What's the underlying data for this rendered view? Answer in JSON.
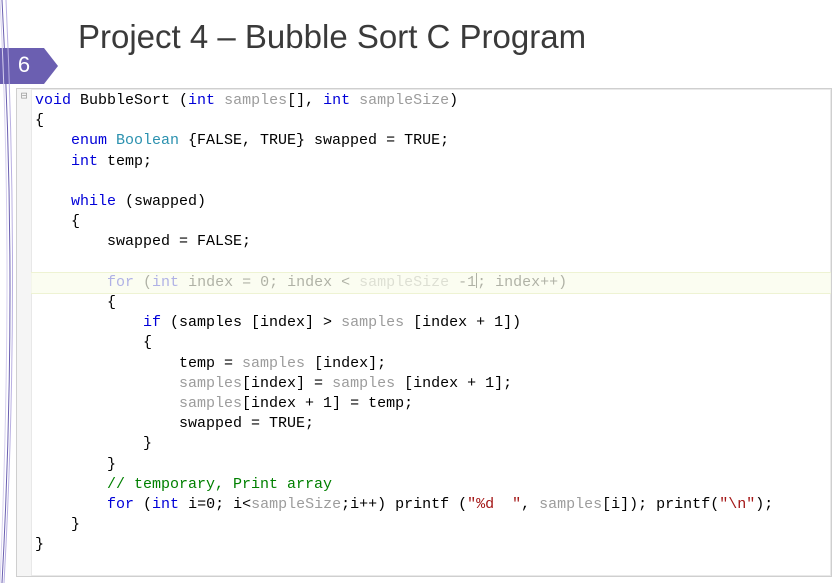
{
  "slide": {
    "number": "6",
    "title": "Project 4 – Bubble Sort C Program"
  },
  "code": {
    "fold_glyph": "⊟",
    "lines": {
      "l1a": "void",
      "l1b": " BubbleSort (",
      "l1c": "int",
      "l1d": " samples",
      "l1e": "[], ",
      "l1f": "int",
      "l1g": " sampleSize",
      "l1h": ")",
      "l2": "{",
      "l3a": "    enum",
      "l3b": " Boolean ",
      "l3c": "{FALSE, TRUE} swapped = TRUE;",
      "l4a": "    int",
      "l4b": " temp;",
      "l5": "",
      "l6a": "    while",
      "l6b": " (swapped)",
      "l7": "    {",
      "l8": "        swapped = FALSE;",
      "l9": "",
      "l10a": "        for",
      "l10b": " (",
      "l10c": "int",
      "l10d": " index = 0; index < ",
      "l10e": "sampleSize",
      "l10f": " -1",
      "l10g": "; index++)",
      "l11": "        {",
      "l12a": "            if",
      "l12b": " (samples [index] > ",
      "l12c": "samples",
      "l12d": " [index + 1])",
      "l13": "            {",
      "l14a": "                temp = ",
      "l14b": "samples",
      "l14c": " [index];",
      "l15a": "                samples",
      "l15b": "[index] = ",
      "l15c": "samples",
      "l15d": " [index + 1];",
      "l16a": "                samples",
      "l16b": "[index + 1] = temp;",
      "l17": "                swapped = TRUE;",
      "l18": "            }",
      "l19": "        }",
      "l20a": "        // temporary, Print array",
      "l21a": "        for",
      "l21b": " (",
      "l21c": "int",
      "l21d": " i=0; i<",
      "l21e": "sampleSize",
      "l21f": ";i++) printf (",
      "l21g": "\"%d  \"",
      "l21h": ", ",
      "l21i": "samples",
      "l21j": "[i]); printf(",
      "l21k": "\"\\n\"",
      "l21l": ");",
      "l22": "    }",
      "l23": "}"
    }
  }
}
